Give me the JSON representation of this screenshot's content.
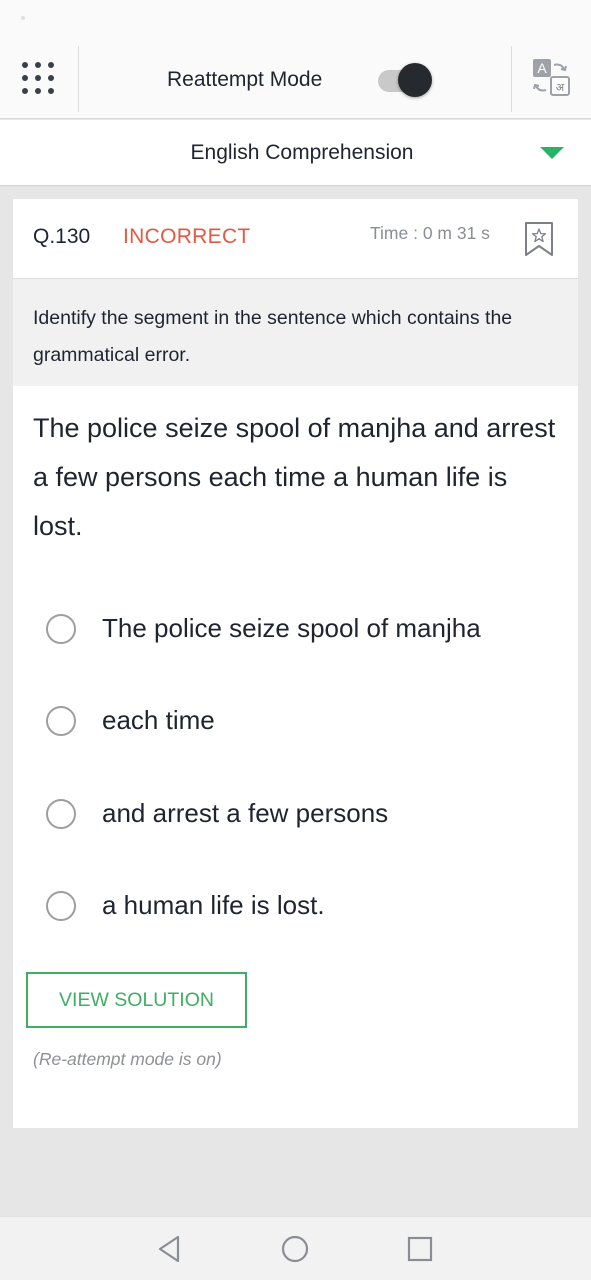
{
  "header": {
    "mode_label": "Reattempt Mode",
    "mode_enabled": true,
    "menu_icon": "grid-menu-icon",
    "translate_icon": "translate-icon",
    "translate_glyphs": [
      "A",
      "अ"
    ]
  },
  "subject": {
    "label": "English Comprehension",
    "arrow_color": "#27b469"
  },
  "question": {
    "number": "Q.130",
    "status": "INCORRECT",
    "status_color": "#e25a44",
    "time": "Time : 0 m 31 s",
    "instruction": "Identify the segment in the sentence which contains the grammatical error.",
    "text": "The police seize spool of manjha and arrest a few persons each time a human life is lost.",
    "options": [
      "The police seize spool of manjha",
      "each time",
      "and arrest a few persons",
      "a human life is lost."
    ]
  },
  "actions": {
    "view_solution": "VIEW SOLUTION",
    "accent_color": "#3fae63",
    "note": "(Re-attempt mode is on)"
  },
  "navigation": {
    "icons": [
      "back-icon",
      "home-icon",
      "recent-apps-icon"
    ]
  }
}
